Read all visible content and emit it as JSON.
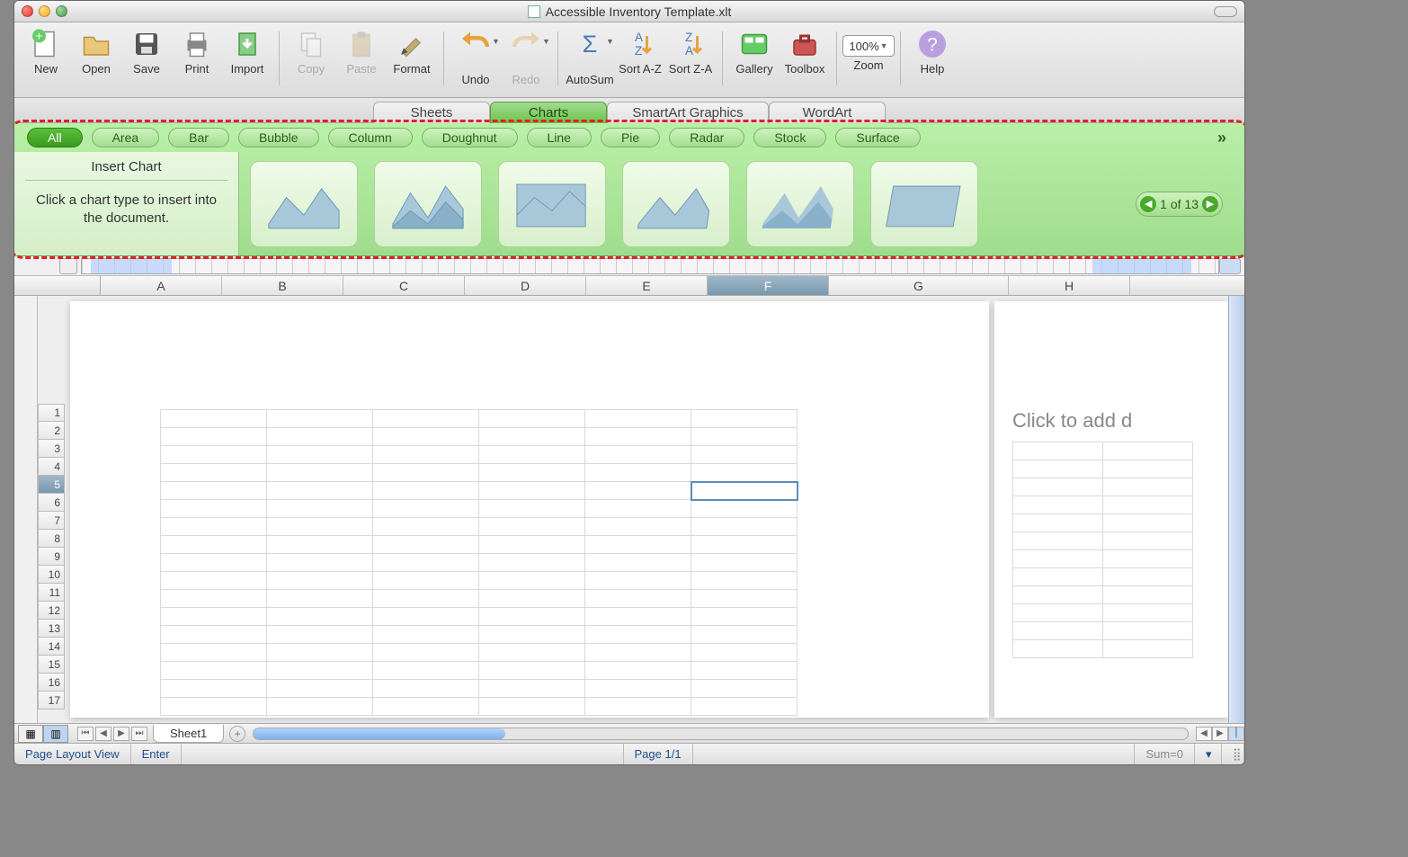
{
  "window": {
    "title": "Accessible Inventory Template.xlt"
  },
  "toolbar": [
    {
      "id": "new",
      "label": "New"
    },
    {
      "id": "open",
      "label": "Open"
    },
    {
      "id": "save",
      "label": "Save"
    },
    {
      "id": "print",
      "label": "Print"
    },
    {
      "id": "import",
      "label": "Import"
    },
    {
      "sep": true
    },
    {
      "id": "copy",
      "label": "Copy",
      "disabled": true
    },
    {
      "id": "paste",
      "label": "Paste",
      "disabled": true
    },
    {
      "id": "format",
      "label": "Format"
    },
    {
      "sep": true
    },
    {
      "id": "undo",
      "label": "Undo",
      "dd": true
    },
    {
      "id": "redo",
      "label": "Redo",
      "disabled": true,
      "dd": true
    },
    {
      "sep": true
    },
    {
      "id": "autosum",
      "label": "AutoSum",
      "dd": true
    },
    {
      "id": "sortaz",
      "label": "Sort A-Z"
    },
    {
      "id": "sortza",
      "label": "Sort Z-A"
    },
    {
      "sep": true
    },
    {
      "id": "gallery",
      "label": "Gallery"
    },
    {
      "id": "toolbox",
      "label": "Toolbox"
    },
    {
      "sep": true
    },
    {
      "id": "zoom",
      "label": "Zoom",
      "zoomvalue": "100%"
    },
    {
      "sep": true
    },
    {
      "id": "help",
      "label": "Help"
    }
  ],
  "ribbon_tabs": [
    {
      "label": "Sheets"
    },
    {
      "label": "Charts",
      "active": true
    },
    {
      "label": "SmartArt Graphics",
      "wide": true
    },
    {
      "label": "WordArt"
    }
  ],
  "chart_categories": [
    "All",
    "Area",
    "Bar",
    "Bubble",
    "Column",
    "Doughnut",
    "Line",
    "Pie",
    "Radar",
    "Stock",
    "Surface"
  ],
  "chart_active_category": "All",
  "insert_panel": {
    "header": "Insert Chart",
    "desc": "Click a chart type to insert into the document."
  },
  "pager": {
    "text": "1 of 13"
  },
  "columns": [
    "A",
    "B",
    "C",
    "D",
    "E",
    "F",
    "G",
    "H"
  ],
  "selected_column": "F",
  "rows": [
    1,
    2,
    3,
    4,
    5,
    6,
    7,
    8,
    9,
    10,
    11,
    12,
    13,
    14,
    15,
    16,
    17
  ],
  "selected_row": 5,
  "page2_placeholder": "Click to add d",
  "sheet_tab": "Sheet1",
  "status": {
    "view": "Page Layout View",
    "mode": "Enter",
    "page": "Page 1/1",
    "sum": "Sum=0"
  }
}
